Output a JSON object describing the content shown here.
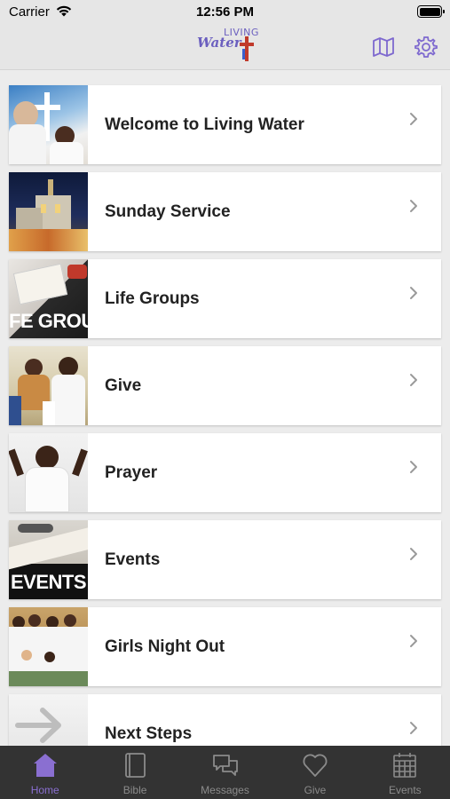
{
  "status_bar": {
    "carrier": "Carrier",
    "time": "12:56 PM"
  },
  "header": {
    "logo_top": "LIVING",
    "logo_main": "Water",
    "accent_color": "#6b5fbf"
  },
  "menu_items": [
    {
      "label": "Welcome to Living Water",
      "thumb_text": ""
    },
    {
      "label": "Sunday Service",
      "thumb_text": ""
    },
    {
      "label": "Life Groups",
      "thumb_text": "FE GROUP"
    },
    {
      "label": "Give",
      "thumb_text": ""
    },
    {
      "label": "Prayer",
      "thumb_text": ""
    },
    {
      "label": "Events",
      "thumb_text": "EVENTS"
    },
    {
      "label": "Girls Night Out",
      "thumb_text": ""
    },
    {
      "label": "Next Steps",
      "thumb_text": ""
    }
  ],
  "tabs": [
    {
      "label": "Home",
      "icon": "home-icon",
      "active": true
    },
    {
      "label": "Bible",
      "icon": "book-icon",
      "active": false
    },
    {
      "label": "Messages",
      "icon": "chat-icon",
      "active": false
    },
    {
      "label": "Give",
      "icon": "heart-icon",
      "active": false
    },
    {
      "label": "Events",
      "icon": "calendar-icon",
      "active": false
    }
  ]
}
